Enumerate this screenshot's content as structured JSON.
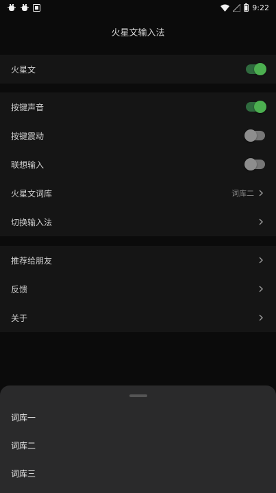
{
  "status_bar": {
    "time": "9:22",
    "left_icons": [
      "bug-icon",
      "bug-icon",
      "screenshot-icon"
    ],
    "right_icons": [
      "wifi-icon",
      "signal-icon",
      "battery-icon"
    ]
  },
  "appbar": {
    "title": "火星文输入法"
  },
  "section1": {
    "items": [
      {
        "label": "火星文",
        "type": "toggle",
        "on": true
      }
    ]
  },
  "section2": {
    "items": [
      {
        "label": "按键声音",
        "type": "toggle",
        "on": true
      },
      {
        "label": "按键震动",
        "type": "toggle",
        "on": false
      },
      {
        "label": "联想输入",
        "type": "toggle",
        "on": false
      },
      {
        "label": "火星文词库",
        "type": "link",
        "value": "词库二"
      },
      {
        "label": "切换输入法",
        "type": "link"
      }
    ]
  },
  "section3": {
    "items": [
      {
        "label": "推荐给朋友",
        "type": "link"
      },
      {
        "label": "反馈",
        "type": "link"
      },
      {
        "label": "关于",
        "type": "link"
      }
    ]
  },
  "bottom_sheet": {
    "options": [
      "词库一",
      "词库二",
      "词库三"
    ]
  },
  "colors": {
    "toggle_on": "#4caf50",
    "toggle_off": "#8d8d8d",
    "background": "#0b0b0b",
    "section_bg": "#151515",
    "sheet_bg": "#2a2a2b"
  }
}
